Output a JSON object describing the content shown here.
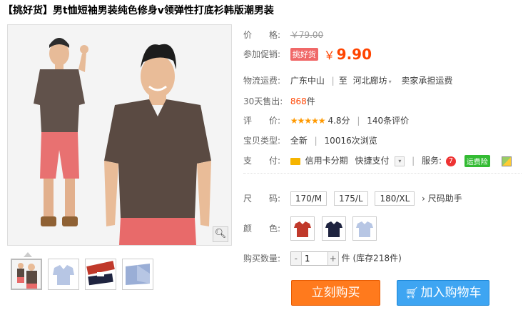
{
  "product": {
    "title": "【挑好货】男t恤短袖男装纯色修身v领弹性打底衫韩版潮男装"
  },
  "price": {
    "label": "价　　格:",
    "original": "￥79.00",
    "promo_label": "参加促销:",
    "promo_tag": "挑好货",
    "currency": "￥",
    "current": "9.90"
  },
  "shipping": {
    "label": "物流运费:",
    "from": "广东中山",
    "to_word": "至",
    "to": "河北廊坊",
    "fee": "卖家承担运费"
  },
  "sales": {
    "label": "30天售出:",
    "count": "868",
    "unit": "件"
  },
  "rating": {
    "label": "评　　价:",
    "stars": "★★★★★",
    "score": "4.8分",
    "reviews": "140条评价"
  },
  "product_type": {
    "label": "宝贝类型:",
    "condition": "全新",
    "views": "10016次浏览"
  },
  "payment": {
    "label": "支　　付:",
    "credit": "信用卡分期",
    "quick": "快捷支付",
    "service_label": "服务:",
    "freight_insurance": "运费险"
  },
  "size": {
    "label": "尺　　码:",
    "options": [
      "170/M",
      "175/L",
      "180/XL"
    ],
    "helper": "› 尺码助手"
  },
  "color": {
    "label": "颜　　色:",
    "swatches": [
      {
        "name": "red",
        "hex": "#c0392b"
      },
      {
        "name": "navy",
        "hex": "#1f2440"
      },
      {
        "name": "light-blue",
        "hex": "#b7c6e4"
      }
    ]
  },
  "quantity": {
    "label": "购买数量:",
    "minus": "-",
    "value": "1",
    "plus": "+",
    "unit": "件",
    "stock": "(库存218件)"
  },
  "actions": {
    "buy_now": "立刻购买",
    "add_to_cart": "加入购物车"
  },
  "colors": {
    "accent": "#ff4400",
    "buy": "#ff7a1d",
    "cart": "#3ea5f2",
    "shirt": "#5a4a42",
    "shorts": "#e86a6a"
  }
}
